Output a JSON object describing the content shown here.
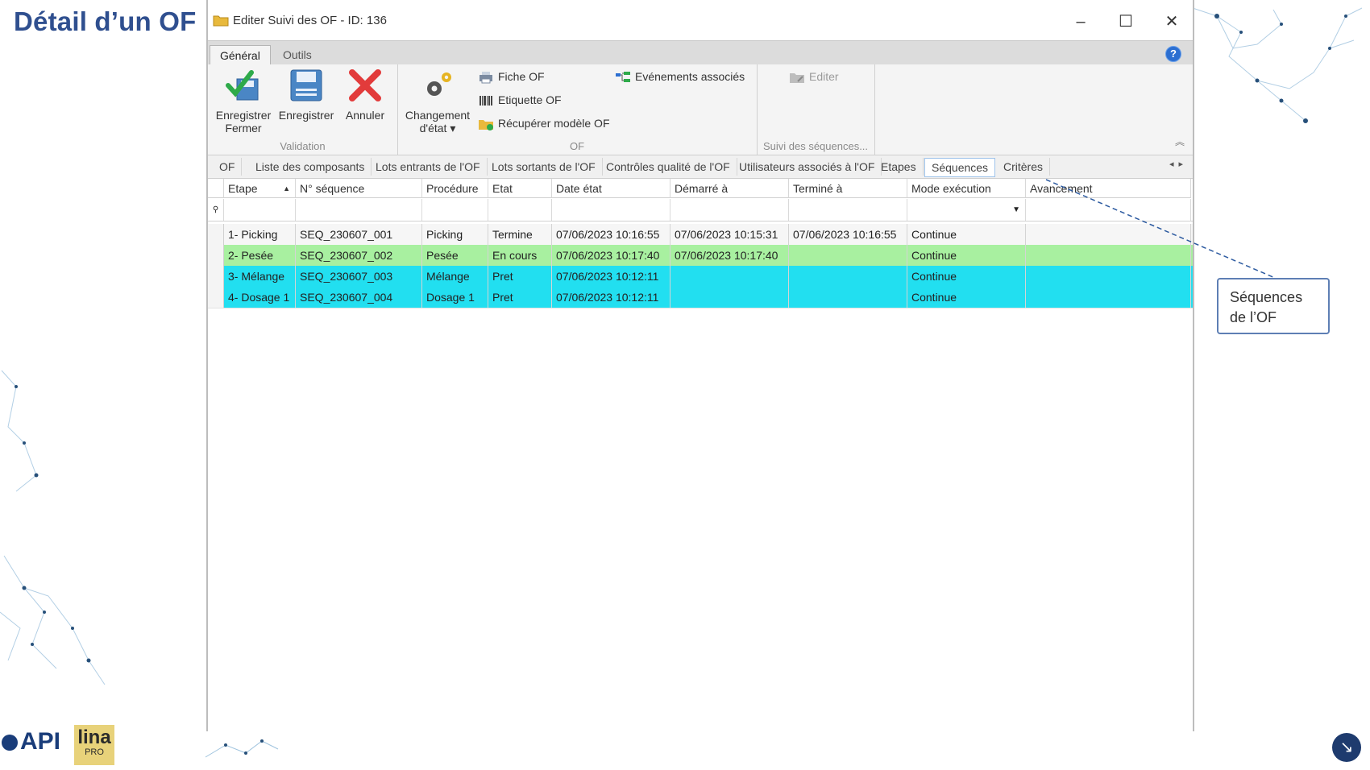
{
  "slide": {
    "title": "Détail d’un OF"
  },
  "window": {
    "title": "Editer Suivi des OF - ID: 136",
    "minimize_glyph": "–",
    "maximize_glyph": "☐",
    "close_glyph": "✕"
  },
  "ribbon_tabs": [
    {
      "label": "Général",
      "active": true
    },
    {
      "label": "Outils",
      "active": false
    }
  ],
  "help_glyph": "?",
  "ribbon": {
    "validation": {
      "label": "Validation",
      "save_close": [
        "Enregistrer",
        "Fermer"
      ],
      "save": "Enregistrer",
      "cancel": "Annuler"
    },
    "of": {
      "label": "OF",
      "change_state": [
        "Changement",
        "d'état ▾"
      ],
      "fiche": "Fiche OF",
      "etiquette": "Etiquette OF",
      "recuperer": "Récupérer modèle OF",
      "evenements": "Evénements associés"
    },
    "suivi": {
      "label": "Suivi des séquences...",
      "edit": "Editer"
    }
  },
  "page_tabs": [
    {
      "label": "OF"
    },
    {
      "label": "Liste des composants"
    },
    {
      "label": "Lots entrants de l'OF"
    },
    {
      "label": "Lots sortants de l'OF"
    },
    {
      "label": "Contrôles qualité de l'OF"
    },
    {
      "label": "Utilisateurs associés à l'OF"
    },
    {
      "label": "Etapes"
    },
    {
      "label": "Séquences",
      "active": true
    },
    {
      "label": "Critères"
    }
  ],
  "grid": {
    "columns": [
      "Etape",
      "N° séquence",
      "Procédure",
      "Etat",
      "Date état",
      "Démarré à",
      "Terminé à",
      "Mode exécution",
      "Avancement"
    ],
    "rows": [
      {
        "etape": "1- Picking",
        "sequence": "SEQ_230607_001",
        "procedure": "Picking",
        "etat": "Termine",
        "date_etat": "07/06/2023 10:16:55",
        "demarre": "07/06/2023 10:15:31",
        "termine": "07/06/2023 10:16:55",
        "mode": "Continue",
        "avancement": "",
        "color": "#f6f6f6"
      },
      {
        "etape": "2- Pesée",
        "sequence": "SEQ_230607_002",
        "procedure": "Pesée",
        "etat": "En cours",
        "date_etat": "07/06/2023 10:17:40",
        "demarre": "07/06/2023 10:17:40",
        "termine": "",
        "mode": "Continue",
        "avancement": "",
        "color": "#a8f0a0"
      },
      {
        "etape": "3- Mélange",
        "sequence": "SEQ_230607_003",
        "procedure": "Mélange",
        "etat": "Pret",
        "date_etat": "07/06/2023 10:12:11",
        "demarre": "",
        "termine": "",
        "mode": "Continue",
        "avancement": "",
        "color": "#22dff0"
      },
      {
        "etape": "4- Dosage 1",
        "sequence": "SEQ_230607_004",
        "procedure": "Dosage 1",
        "etat": "Pret",
        "date_etat": "07/06/2023 10:12:11",
        "demarre": "",
        "termine": "",
        "mode": "Continue",
        "avancement": "",
        "color": "#22dff0"
      }
    ]
  },
  "callout": {
    "line1": "Séquences",
    "line2": "de l’OF"
  },
  "logos": {
    "api": "API",
    "lina": "lina",
    "pro": "PRO"
  },
  "colors": {
    "title": "#2f4f8f",
    "in_progress": "#a8f0a0",
    "ready": "#22dff0",
    "accent": "#2c6fd1"
  }
}
